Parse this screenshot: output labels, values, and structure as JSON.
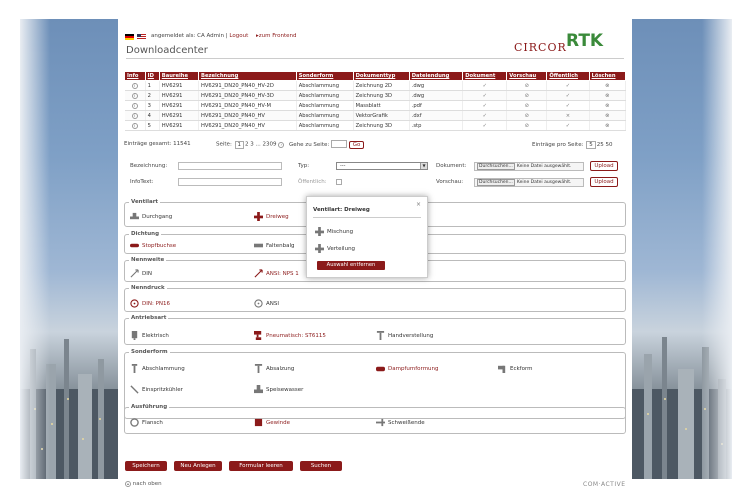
{
  "header": {
    "logged_in": "angemeldet als: CA Admin",
    "logout": "Logout",
    "frontend": "zum Frontend",
    "title": "Downloadcenter",
    "brand1": "CIRCOR",
    "brand2": "RTK"
  },
  "table": {
    "headers": [
      "Info",
      "ID",
      "Baureihe",
      "Bezeichnung",
      "Sonderform",
      "Dokumenttyp",
      "Dateiendung",
      "Dokument",
      "Vorschau",
      "Öffentlich",
      "Löschen"
    ],
    "rows": [
      [
        "1",
        "HV6291",
        "HV6291_DN20_PN40_HV-2D",
        "Abschlammung",
        "Zeichnung 2D",
        ".dwg"
      ],
      [
        "2",
        "HV6291",
        "HV6291_DN20_PN40_HV-3D",
        "Abschlammung",
        "Zeichnung 3D",
        ".dwg"
      ],
      [
        "3",
        "HV6291",
        "HV6291_DN20_PN40_HV-M",
        "Abschlammung",
        "Massblatt",
        ".pdf"
      ],
      [
        "4",
        "HV6291",
        "HV6291_DN20_PN40_HV",
        "Abschlammung",
        "VektorGrafik",
        ".dxf"
      ],
      [
        "5",
        "HV6291",
        "HV6291_DN20_PN40_HV",
        "Abschlammung",
        "Zeichnung 3D",
        ".stp"
      ]
    ]
  },
  "pager": {
    "total": "Einträge gesamt: 11541",
    "seite": "Seite:",
    "p1": "1",
    "p2": "2",
    "p3": "3",
    "dots": "...",
    "plast": "2309",
    "goto": "Gehe zu Seite:",
    "go": "Go",
    "per_page": "Einträge pro Seite:",
    "pp1": "5",
    "pp2": "25",
    "pp3": "50"
  },
  "form": {
    "bez": "Bezeichnung:",
    "typ": "Typ:",
    "typ_val": "---",
    "dok": "Dokument:",
    "browse": "Durchsuchen...",
    "nofile": "Keine Datei ausgewählt.",
    "upload": "Upload",
    "info": "InfoText:",
    "public": "Öffentlich:",
    "vorschau": "Vorschau:"
  },
  "groups": {
    "ventilart": {
      "legend": "Ventilart",
      "a": "Durchgang",
      "b": "Dreiweg"
    },
    "dichtung": {
      "legend": "Dichtung",
      "a": "Stopfbuchse",
      "b": "Faltenbalg"
    },
    "nennweite": {
      "legend": "Nennweite",
      "a": "DIN",
      "b": "ANSI: NPS 1"
    },
    "nenndruck": {
      "legend": "Nenndruck",
      "a": "DIN: PN16",
      "b": "ANSI"
    },
    "antrieb": {
      "legend": "Antriebsart",
      "a": "Elektrisch",
      "b": "Pneumatisch: ST6115",
      "c": "Handverstellung"
    },
    "sonderform": {
      "legend": "Sonderform",
      "a": "Abschlammung",
      "b": "Absalzung",
      "c": "Dampfumformung",
      "d": "Eckform",
      "e": "Einspritzkühler",
      "f": "Speisewasser"
    },
    "ausfuehrung": {
      "legend": "Ausführung",
      "a": "Flansch",
      "b": "Gewinde",
      "c": "Schweißende"
    }
  },
  "popup": {
    "title": "Ventilart: Dreiweg",
    "close": "×",
    "o1": "Mischung",
    "o2": "Verteilung",
    "btn": "Auswahl entfernen"
  },
  "buttons": {
    "save": "Speichern",
    "new": "Neu Anlegen",
    "clear": "Formular leeren",
    "search": "Suchen"
  },
  "footer": {
    "top": "nach oben",
    "brand": "COM·ACTIVE"
  },
  "colors": {
    "accent": "#8b1a1a",
    "green": "#3a8a3a"
  }
}
